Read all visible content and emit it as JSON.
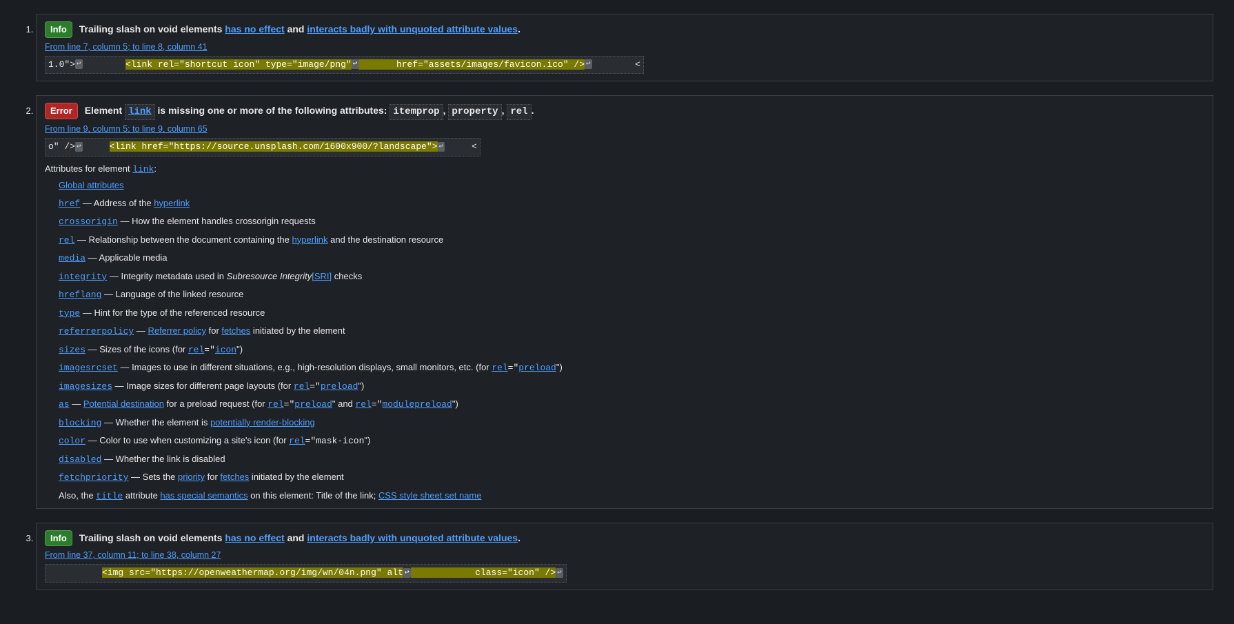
{
  "messages": [
    {
      "num": "1.",
      "badge": "Info",
      "badgeClass": "badge-info",
      "heading_pre": "Trailing slash on void elements ",
      "heading_link1": "has no effect",
      "heading_mid": " and ",
      "heading_link2": "interacts badly with unquoted attribute values",
      "heading_post": ".",
      "location": "From line 7, column 5; to line 8, column 41",
      "extract_pre": "1.0\">",
      "extract_gap1": "        ",
      "extract_hl_a": "<link rel=\"shortcut icon\" type=\"image/png\"",
      "extract_gap2": "       ",
      "extract_hl_b": "href=\"assets/images/favicon.ico\" />",
      "extract_post": "        <"
    },
    {
      "num": "2.",
      "badge": "Error",
      "badgeClass": "badge-error",
      "heading_pre": "Element ",
      "heading_elem": "link",
      "heading_mid": " is missing one or more of the following attributes: ",
      "heading_attr1": "itemprop",
      "heading_attr2": "property",
      "heading_attr3": "rel",
      "location": "From line 9, column 5; to line 9, column 65",
      "extract_pre": "o\" />",
      "extract_gap1": "     ",
      "extract_hl": "<link href=\"https://source.unsplash.com/1600x900/?landscape\">",
      "extract_post": "     <",
      "desc_intro_pre": "Attributes for element ",
      "desc_intro_link": "link",
      "desc_intro_post": ":",
      "global_attrs": "Global attributes",
      "attrs": [
        {
          "name": "href",
          "sep": " — ",
          "desc_pre": "Address of the ",
          "link1": "hyperlink",
          "desc_post": ""
        },
        {
          "name": "crossorigin",
          "sep": " — ",
          "desc_pre": "How the element handles crossorigin requests",
          "link1": "",
          "desc_post": ""
        },
        {
          "name": "rel",
          "sep": " — ",
          "desc_pre": "Relationship between the document containing the ",
          "link1": "hyperlink",
          "desc_post": " and the destination resource"
        },
        {
          "name": "media",
          "sep": " — ",
          "desc_pre": "Applicable media",
          "link1": "",
          "desc_post": ""
        },
        {
          "name": "integrity",
          "sep": " — ",
          "desc_pre": "Integrity metadata used in ",
          "em": "Subresource Integrity",
          "desc_mid": " checks ",
          "link1": "[SRI]",
          "desc_post": ""
        },
        {
          "name": "hreflang",
          "sep": " — ",
          "desc_pre": "Language of the linked resource",
          "link1": "",
          "desc_post": ""
        },
        {
          "name": "type",
          "sep": " — ",
          "desc_pre": "Hint for the type of the referenced resource",
          "link1": "",
          "desc_post": ""
        },
        {
          "name": "referrerpolicy",
          "sep": " — ",
          "link1": "Referrer policy",
          "desc_mid": " for ",
          "link2": "fetches",
          "desc_post": " initiated by the element"
        },
        {
          "name": "sizes",
          "sep": " — ",
          "desc_pre": "Sizes of the icons (for ",
          "linkc": "rel",
          "eq": "=\"",
          "linkc2": "icon",
          "desc_post": "\")"
        },
        {
          "name": "imagesrcset",
          "sep": " — ",
          "desc_pre": "Images to use in different situations, e.g., high-resolution displays, small monitors, etc. (for ",
          "linkc": "rel",
          "eq": "=\"",
          "linkc2": "preload",
          "desc_post": "\")"
        },
        {
          "name": "imagesizes",
          "sep": " — ",
          "desc_pre": "Image sizes for different page layouts (for ",
          "linkc": "rel",
          "eq": "=\"",
          "linkc2": "preload",
          "desc_post": "\")"
        },
        {
          "name": "as",
          "sep": " — ",
          "link1": "Potential destination",
          "desc_mid": " for a preload request (for ",
          "linkc": "rel",
          "eq": "=\"",
          "linkc2": "preload",
          "desc_mid2": "\" and ",
          "linkc3": "rel",
          "eq2": "=\"",
          "linkc4": "modulepreload",
          "desc_post": "\")"
        },
        {
          "name": "blocking",
          "sep": " — ",
          "desc_pre": "Whether the element is ",
          "link1": "potentially render-blocking",
          "desc_post": ""
        },
        {
          "name": "color",
          "sep": " — ",
          "desc_pre": "Color to use when customizing a site's icon (for ",
          "linkc": "rel",
          "eq": "=\"",
          "plain": "mask-icon",
          "desc_post": "\")"
        },
        {
          "name": "disabled",
          "sep": " — ",
          "desc_pre": "Whether the link is disabled",
          "link1": "",
          "desc_post": ""
        },
        {
          "name": "fetchpriority",
          "sep": " — ",
          "desc_pre": "Sets the ",
          "link1": "priority",
          "desc_mid": " for ",
          "link2": "fetches",
          "desc_post": " initiated by the element"
        }
      ],
      "footer_pre": "Also, the ",
      "footer_title": "title",
      "footer_mid1": " attribute ",
      "footer_link1": "has special semantics",
      "footer_mid2": " on this element: Title of the link; ",
      "footer_link2": "CSS style sheet set name"
    },
    {
      "num": "3.",
      "badge": "Info",
      "badgeClass": "badge-info",
      "heading_pre": "Trailing slash on void elements ",
      "heading_link1": "has no effect",
      "heading_mid": " and ",
      "heading_link2": "interacts badly with unquoted attribute values",
      "heading_post": ".",
      "location": "From line 37, column 11; to line 38, column 27",
      "extract_gap0": "          ",
      "extract_hl_a": "<img src=\"https://openweathermap.org/img/wn/04n.png\" alt",
      "extract_gap1": "            ",
      "extract_hl_b": "class=\"icon\" />",
      "extract_post": ""
    }
  ],
  "nl_char": "↩"
}
